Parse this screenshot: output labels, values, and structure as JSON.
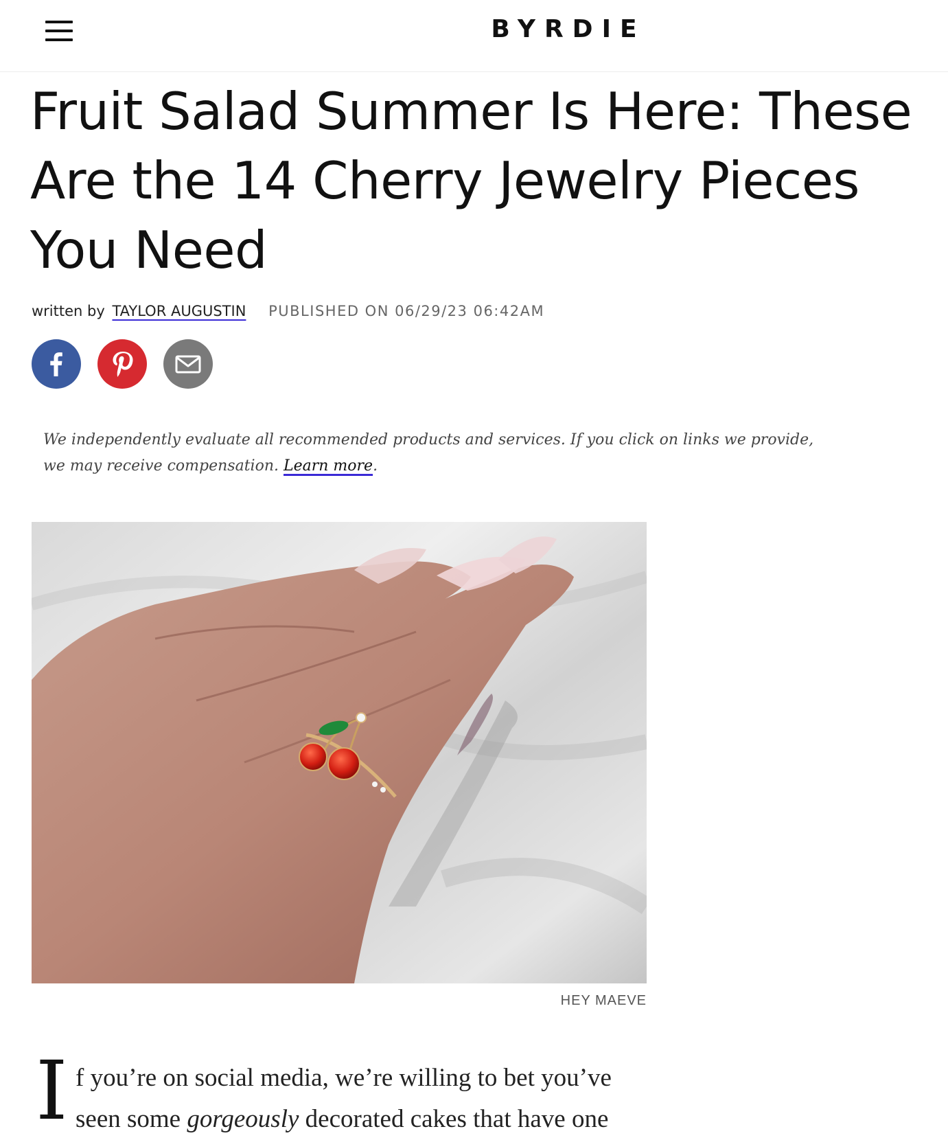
{
  "header": {
    "logo": "BYRDIE",
    "menu_icon": "hamburger-menu-icon"
  },
  "article": {
    "title": "Fruit Salad Summer Is Here: These Are the 14 Cherry Jewelry Pieces You Need",
    "byline_prefix": "written by",
    "author": "TAYLOR AUGUSTIN",
    "published": "PUBLISHED ON 06/29/23 06:42AM"
  },
  "social": {
    "facebook_icon": "facebook-icon",
    "pinterest_icon": "pinterest-icon",
    "email_icon": "email-icon",
    "colors": {
      "facebook": "#3b5ba0",
      "pinterest": "#d62a30",
      "email": "#7a7a7a"
    }
  },
  "disclaimer": {
    "text": "We independently evaluate all recommended products and services. If you click on links we provide, we may receive compensation.",
    "link": "Learn more",
    "period": "."
  },
  "hero": {
    "credit": "HEY MAEVE"
  },
  "body": {
    "dropcap": "I",
    "first_part": "f you’re on social media, we’re willing to bet you’ve seen some ",
    "emphasis": "gorgeously",
    "rest": " decorated cakes that have one"
  },
  "colors": {
    "link_underline": "#3a2ad6",
    "text": "#111111"
  }
}
